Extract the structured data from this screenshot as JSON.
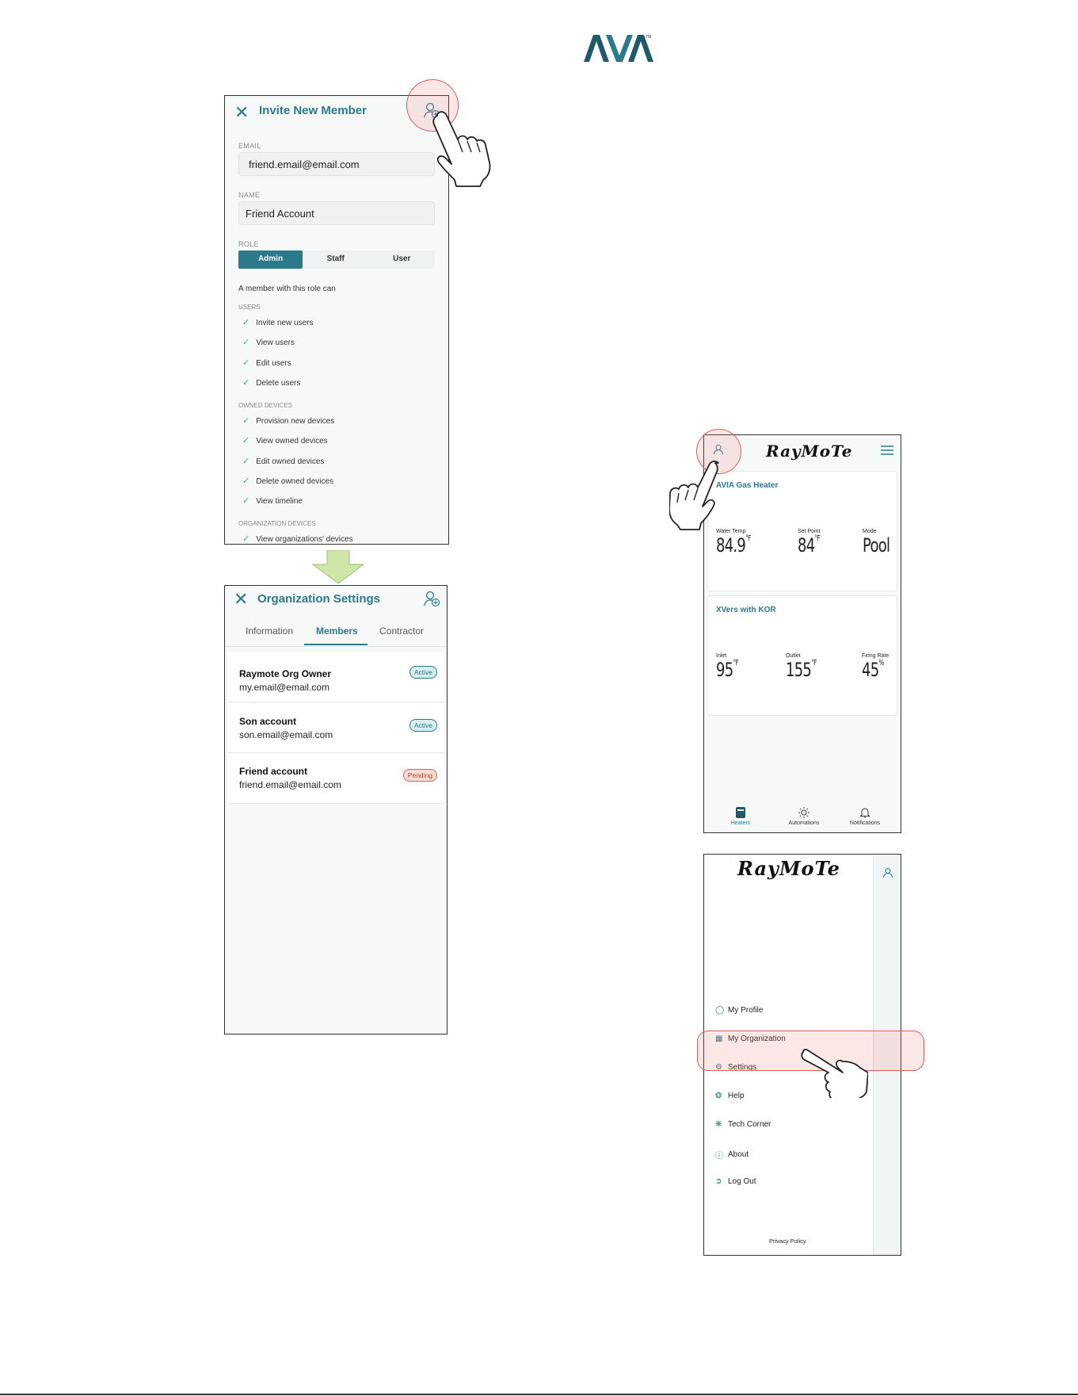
{
  "brand": {
    "logo_text": "AVIA"
  },
  "invite_screen": {
    "title": "Invite New Member",
    "email_label": "EMAIL",
    "email_value": "friend.email@email.com",
    "name_label": "NAME",
    "name_value": "Friend Account",
    "role_label": "ROLE",
    "roles": [
      "Admin",
      "Staff",
      "User"
    ],
    "selected_role": "Admin",
    "role_desc": "A member with this role can",
    "sections": [
      {
        "heading": "USERS",
        "items": [
          "Invite new users",
          "View users",
          "Edit users",
          "Delete users"
        ]
      },
      {
        "heading": "OWNED DEVICES",
        "items": [
          "Provision new devices",
          "View owned devices",
          "Edit owned devices",
          "Delete owned devices",
          "View timeline"
        ]
      },
      {
        "heading": "ORGANIZATION DEVICES",
        "items": [
          "View organizations' devices"
        ]
      }
    ]
  },
  "org_screen": {
    "title": "Organization Settings",
    "tabs": [
      "Information",
      "Members",
      "Contractor"
    ],
    "active_tab": "Members",
    "members": [
      {
        "name": "Raymote Org Owner",
        "email": "my.email@email.com",
        "status": "Active"
      },
      {
        "name": "Son account",
        "email": "son.email@email.com",
        "status": "Active"
      },
      {
        "name": "Friend account",
        "email": "friend.email@email.com",
        "status": "Pending"
      }
    ]
  },
  "home_screen": {
    "logo_text": "RayMoTe",
    "cards": [
      {
        "title": "AVIA Gas Heater",
        "stats": [
          {
            "label": "Water Temp",
            "value": "84.9",
            "unit": "°F"
          },
          {
            "label": "Set Point",
            "value": "84",
            "unit": "°F"
          },
          {
            "label": "Mode",
            "value": "Pool",
            "unit": ""
          }
        ]
      },
      {
        "title": "XVers with KOR",
        "stats": [
          {
            "label": "Inlet",
            "value": "95",
            "unit": "°F"
          },
          {
            "label": "Outlet",
            "value": "155",
            "unit": "°F"
          },
          {
            "label": "Firing Rate",
            "value": "45",
            "unit": "%"
          }
        ]
      }
    ],
    "nav": [
      "Heaters",
      "Automations",
      "Notifications"
    ]
  },
  "menu_screen": {
    "logo_text": "RayMoTe",
    "items": [
      "My Profile",
      "My Organization",
      "Settings",
      "Help",
      "Tech Corner",
      "About",
      "Log Out"
    ],
    "footer": "Privacy Policy"
  },
  "colors": {
    "accent": "#2a7a8c",
    "highlight": "#e25b5b",
    "arrow": "#cfe6a8"
  },
  "icons": [
    "close-icon",
    "add-member-icon",
    "check-icon",
    "user-icon",
    "hamburger-icon",
    "heater-icon",
    "sun-icon",
    "bell-icon",
    "building-icon",
    "gear-icon",
    "help-icon",
    "fan-icon",
    "info-icon",
    "logout-icon",
    "pointing-hand-icon",
    "down-arrow-icon"
  ]
}
